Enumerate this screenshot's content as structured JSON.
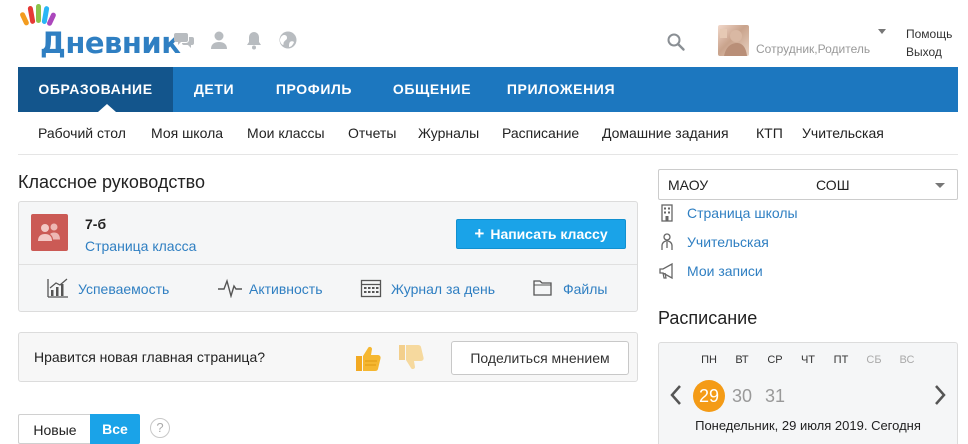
{
  "logo": {
    "text": "Дневник"
  },
  "user": {
    "role": "Сотрудник,Родитель"
  },
  "header_links": {
    "help": "Помощь",
    "exit": "Выход"
  },
  "main_nav": [
    "ОБРАЗОВАНИЕ",
    "ДЕТИ",
    "ПРОФИЛЬ",
    "ОБЩЕНИЕ",
    "ПРИЛОЖЕНИЯ"
  ],
  "active_tab": "ОБРАЗОВАНИЕ",
  "sub_nav": [
    "Рабочий стол",
    "Моя школа",
    "Мои классы",
    "Отчеты",
    "Журналы",
    "Расписание",
    "Домашние задания",
    "КТП",
    "Учительская"
  ],
  "class_section": {
    "title": "Классное руководство",
    "class_name": "7-б",
    "class_page_link": "Страница класса",
    "write_button": "Написать классу",
    "links": [
      "Успеваемость",
      "Активность",
      "Журнал за день",
      "Файлы"
    ]
  },
  "feedback": {
    "question": "Нравится новая главная страница?",
    "share_button": "Поделиться мнением"
  },
  "filters": {
    "new": "Новые",
    "all": "Все",
    "help": "?"
  },
  "school": {
    "select_part1": "МАОУ",
    "select_part2": "СОШ"
  },
  "side_links": [
    "Страница школы",
    "Учительская",
    "Мои записи"
  ],
  "schedule": {
    "title": "Расписание",
    "weekdays": [
      "ПН",
      "ВТ",
      "СР",
      "ЧТ",
      "ПТ",
      "СБ",
      "ВС"
    ],
    "days": [
      "29",
      "30",
      "31"
    ],
    "caption": "Понедельник, 29 июля 2019. Сегодня"
  },
  "colors": {
    "brand_blue": "#1c77bf",
    "active_tab": "#13558c",
    "link": "#2f7fc2",
    "button": "#1aa3e8",
    "today": "#f49b16",
    "class_badge": "#cb5a55"
  }
}
